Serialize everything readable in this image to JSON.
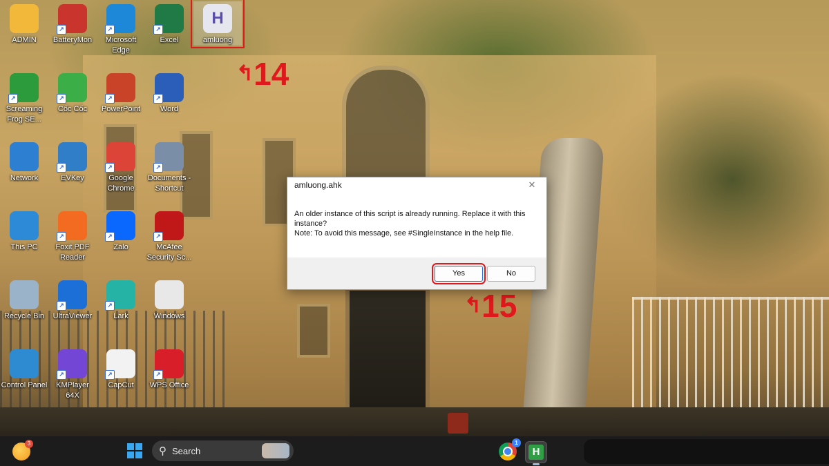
{
  "desktop": {
    "icons": [
      {
        "label": "ADMIN",
        "icon": "folder-user-icon",
        "color": "#f2b83a"
      },
      {
        "label": "BatteryMon",
        "icon": "battery-monitor-icon",
        "color": "#c9342c"
      },
      {
        "label": "Microsoft Edge",
        "icon": "edge-icon",
        "color": "#1e88d8"
      },
      {
        "label": "Excel",
        "icon": "excel-icon",
        "color": "#1f7a45"
      },
      {
        "label": "amluong",
        "icon": "ahk-script-icon",
        "color": "#e6e6ee"
      },
      {
        "label": "Screaming Frog SE...",
        "icon": "screaming-frog-icon",
        "color": "#2c9b3b"
      },
      {
        "label": "Cốc Cốc",
        "icon": "coccoc-icon",
        "color": "#3cae47"
      },
      {
        "label": "PowerPoint",
        "icon": "powerpoint-icon",
        "color": "#c84328"
      },
      {
        "label": "Word",
        "icon": "word-icon",
        "color": "#2b5eb8"
      },
      {
        "label": "Network",
        "icon": "network-icon",
        "color": "#2d7fd2"
      },
      {
        "label": "EVKey",
        "icon": "evkey-icon",
        "color": "#2f7ec7"
      },
      {
        "label": "Google Chrome",
        "icon": "chrome-icon",
        "color": "#db4437"
      },
      {
        "label": "Documents - Shortcut",
        "icon": "documents-folder-icon",
        "color": "#7b8ea8"
      },
      {
        "label": "This PC",
        "icon": "this-pc-icon",
        "color": "#2c8ad6"
      },
      {
        "label": "Foxit PDF Reader",
        "icon": "foxit-pdf-icon",
        "color": "#f26b21"
      },
      {
        "label": "Zalo",
        "icon": "zalo-icon",
        "color": "#0a68ff"
      },
      {
        "label": "McAfee Security Sc...",
        "icon": "mcafee-icon",
        "color": "#c01818"
      },
      {
        "label": "Recycle Bin",
        "icon": "recycle-bin-icon",
        "color": "#9ab3c9"
      },
      {
        "label": "UltraViewer",
        "icon": "ultraviewer-icon",
        "color": "#1c6fd6"
      },
      {
        "label": "Lark",
        "icon": "lark-icon",
        "color": "#25b3a6"
      },
      {
        "label": "Windows",
        "icon": "windows-file-icon",
        "color": "#e8e8e8"
      },
      {
        "label": "Control Panel",
        "icon": "control-panel-icon",
        "color": "#2f8bd1"
      },
      {
        "label": "KMPlayer 64X",
        "icon": "kmplayer-icon",
        "color": "#7446d6"
      },
      {
        "label": "CapCut",
        "icon": "capcut-icon",
        "color": "#f2f2f2"
      },
      {
        "label": "WPS Office",
        "icon": "wps-office-icon",
        "color": "#d81e28"
      }
    ]
  },
  "annotations": {
    "step_a": "14",
    "step_b": "15"
  },
  "dialog": {
    "title": "amluong.ahk",
    "message_line1": "An older instance of this script is already running.  Replace it with this instance?",
    "message_line2": "Note: To avoid this message, see #SingleInstance in the help file.",
    "yes_label": "Yes",
    "no_label": "No",
    "close_glyph": "✕"
  },
  "taskbar": {
    "weather_badge": "3",
    "search_label": "Search",
    "chrome_badge": "1",
    "ahk_glyph": "H"
  }
}
